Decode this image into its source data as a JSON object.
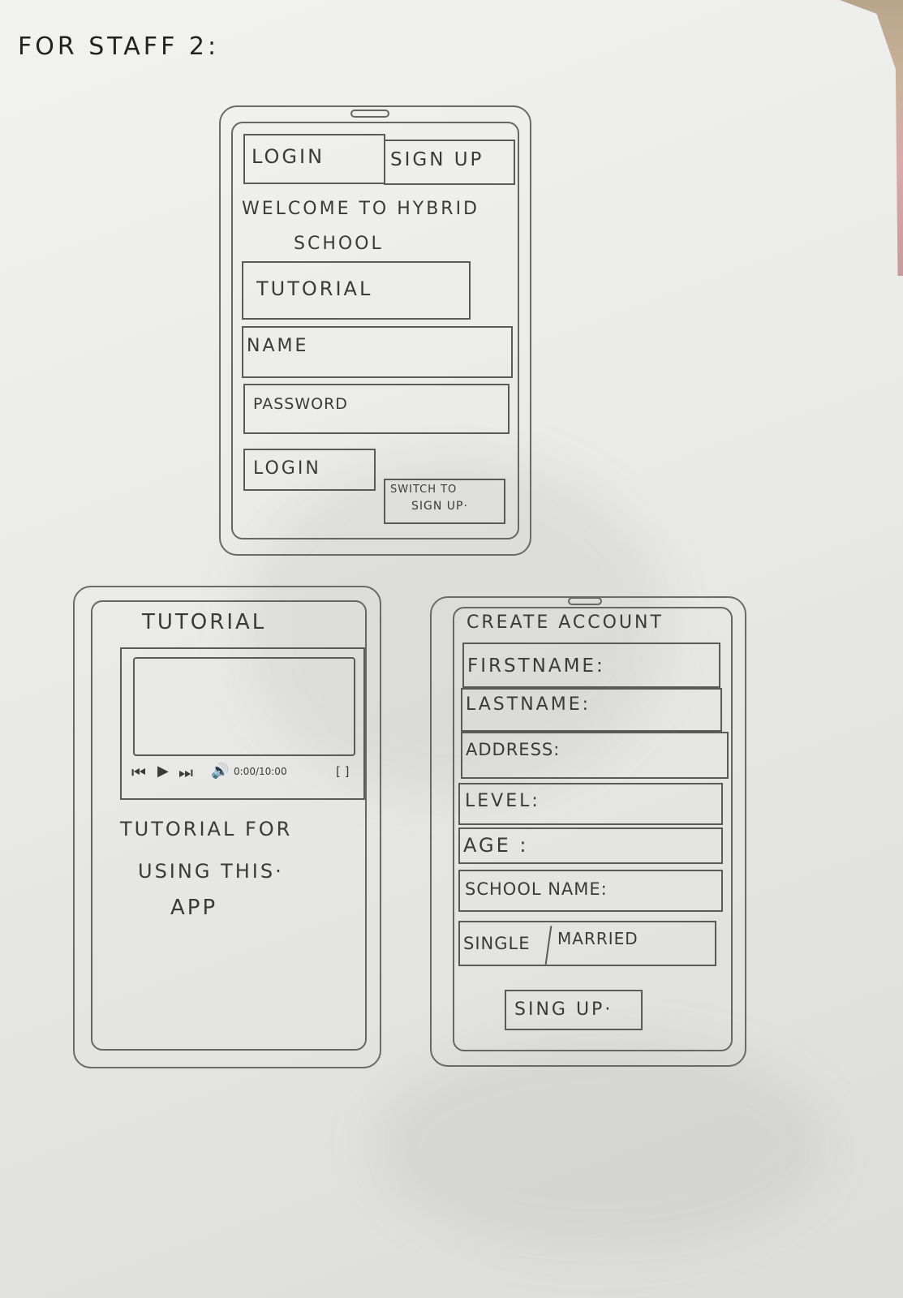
{
  "page_title": "FOR STAFF 2:",
  "screen1": {
    "tab_login": "LOGIN",
    "tab_signup": "SIGN UP",
    "welcome_line1": "WELCOME TO HYBRID",
    "welcome_line2": "SCHOOL",
    "tutorial_button": "TUTORIAL",
    "name_field": "NAME",
    "password_field": "PASSWORD",
    "login_button": "LOGIN",
    "switch_line1": "SWITCH TO",
    "switch_line2": "SIGN UP·"
  },
  "screen2": {
    "title": "TUTORIAL",
    "video_time": "0:00/10:00",
    "desc_line1": "TUTORIAL FOR",
    "desc_line2": "USING THIS·",
    "desc_line3": "APP"
  },
  "screen3": {
    "title": "CREATE ACCOUNT",
    "firstname": "FIRSTNAME:",
    "lastname": "LASTNAME:",
    "address": "ADDRESS:",
    "level": "LEVEL:",
    "age": "AGE :",
    "school_name": "SCHOOL NAME:",
    "single": "SINGLE",
    "married": "MARRIED",
    "signup_button": "SING UP·"
  }
}
